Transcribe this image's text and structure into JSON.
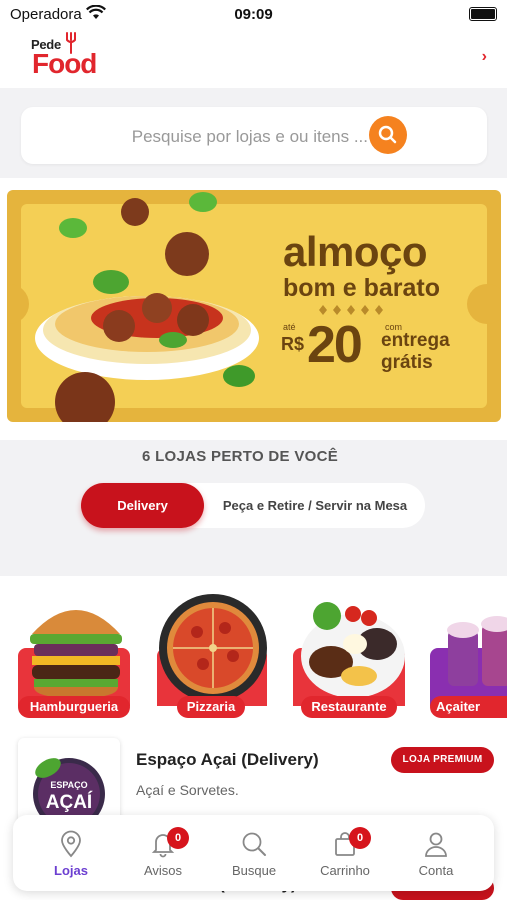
{
  "status_bar": {
    "carrier": "Operadora",
    "time": "09:09"
  },
  "header": {
    "logo_top": "Pede",
    "logo_main": "Food"
  },
  "search": {
    "placeholder": "Pesquise por lojas e ou itens ..."
  },
  "banner": {
    "title_line1": "almoço",
    "title_line2": "bom e barato",
    "ate": "até",
    "currency": "R$",
    "amount": "20",
    "com": "com",
    "entrega": "entrega",
    "gratis": "grátis"
  },
  "nearby_title": "6 LOJAS PERTO DE VOCÊ",
  "toggle": {
    "active": "Delivery",
    "other": "Peça e Retire / Servir na Mesa"
  },
  "categories": [
    {
      "label": "Hamburgueria"
    },
    {
      "label": "Pizzaria"
    },
    {
      "label": "Restaurante"
    },
    {
      "label": "Açaiter"
    }
  ],
  "stores": [
    {
      "name": "Espaço Açai (Delivery)",
      "subtitle": "Açaí e Sorvetes.",
      "badge": "LOJA PREMIUM",
      "logo_text": [
        "ESPAÇO",
        "AÇAÍ"
      ]
    },
    {
      "name": "Alimentar (Delivery)"
    }
  ],
  "tabbar": [
    {
      "label": "Lojas",
      "icon": "map-pin-icon",
      "active": true
    },
    {
      "label": "Avisos",
      "icon": "bell-icon",
      "badge": "0"
    },
    {
      "label": "Busque",
      "icon": "search-icon"
    },
    {
      "label": "Carrinho",
      "icon": "bag-icon",
      "badge": "0"
    },
    {
      "label": "Conta",
      "icon": "user-icon"
    }
  ],
  "colors": {
    "brand_red": "#e1262d",
    "accent_orange": "#f5821f",
    "active_tab": "#6c3fd1",
    "banner_yellow": "#f4cf55"
  }
}
